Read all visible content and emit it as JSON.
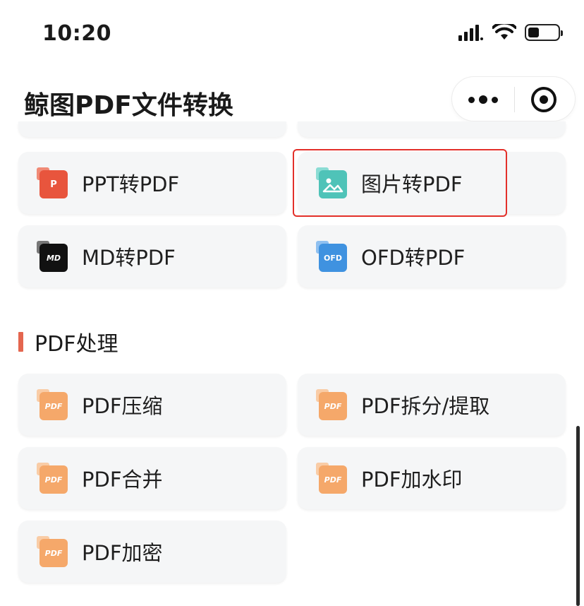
{
  "status_bar": {
    "time": "10:20"
  },
  "header": {
    "title": "鲸图PDF文件转换"
  },
  "convert_tools": [
    {
      "label": "PPT转PDF",
      "icon": "ppt-file-icon",
      "icon_text": "P"
    },
    {
      "label": "图片转PDF",
      "icon": "image-file-icon",
      "icon_text": ""
    },
    {
      "label": "MD转PDF",
      "icon": "md-file-icon",
      "icon_text": "MD"
    },
    {
      "label": "OFD转PDF",
      "icon": "ofd-file-icon",
      "icon_text": "OFD"
    }
  ],
  "pdf_section": {
    "title": "PDF处理",
    "tools": [
      {
        "label": "PDF压缩",
        "icon": "pdf-file-icon",
        "icon_text": "PDF"
      },
      {
        "label": "PDF拆分/提取",
        "icon": "pdf-file-icon",
        "icon_text": "PDF"
      },
      {
        "label": "PDF合并",
        "icon": "pdf-file-icon",
        "icon_text": "PDF"
      },
      {
        "label": "PDF加水印",
        "icon": "pdf-file-icon",
        "icon_text": "PDF"
      },
      {
        "label": "PDF加密",
        "icon": "pdf-file-icon",
        "icon_text": "PDF"
      }
    ]
  },
  "colors": {
    "highlight": "#e3302a",
    "section_accent": "#e4664f",
    "ppt": "#e8553d",
    "image": "#4fc3b8",
    "md": "#111111",
    "ofd": "#3f92e0",
    "pdf": "#f5a86a"
  }
}
